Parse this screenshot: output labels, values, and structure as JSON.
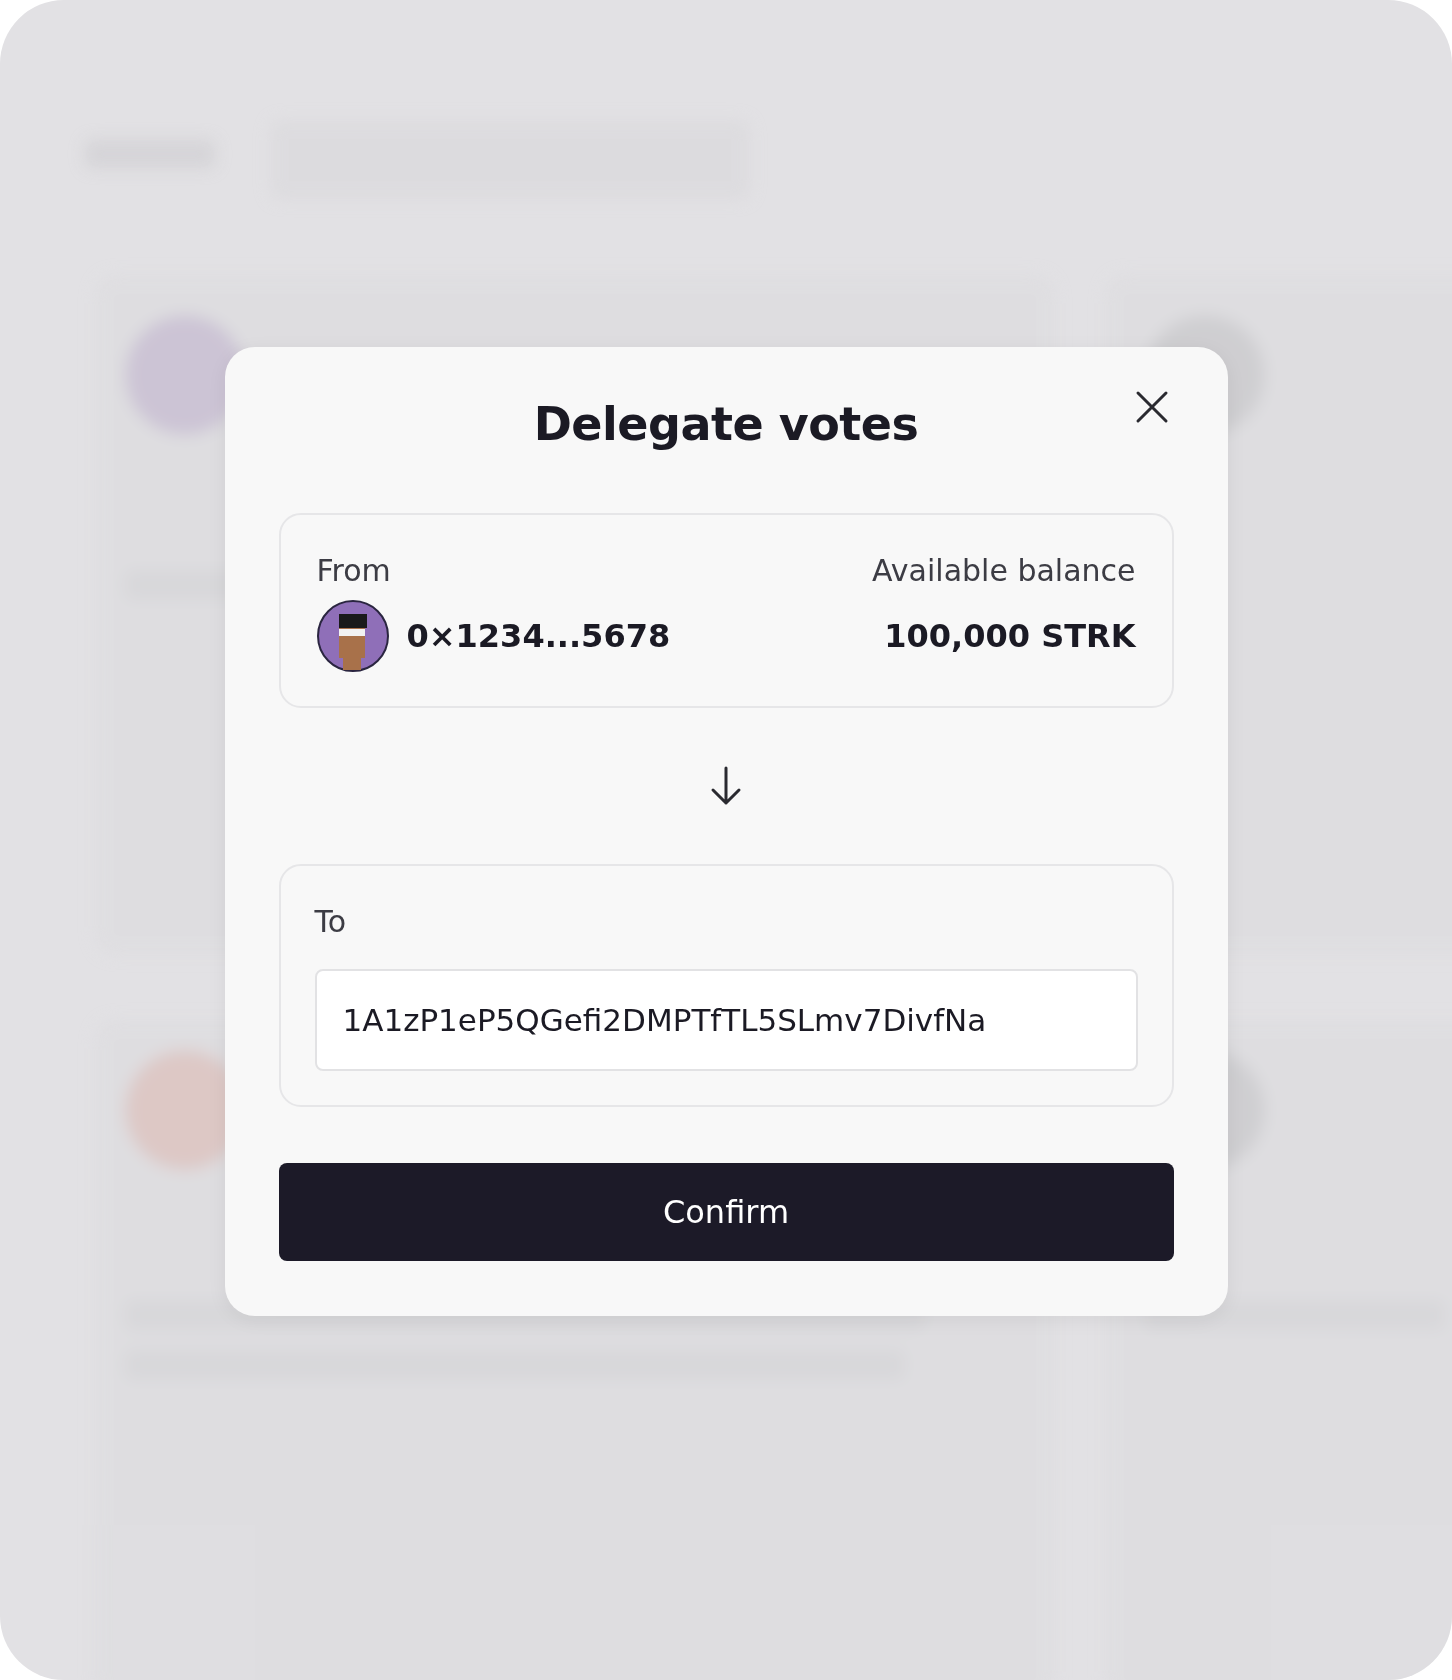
{
  "dialog": {
    "title": "Delegate votes",
    "from": {
      "label": "From",
      "address": "0×1234...5678",
      "balance_label": "Available balance",
      "balance": "100,000 STRK"
    },
    "to": {
      "label": "To",
      "value": "1A1zP1eP5QGefi2DMPTfTL5SLmv7DivfNa"
    },
    "confirm": "Confirm"
  }
}
